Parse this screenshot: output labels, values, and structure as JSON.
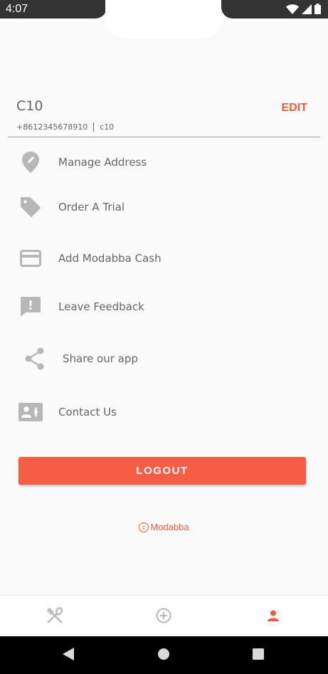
{
  "status_bar": {
    "time": "4:07",
    "icons": [
      "wifi-icon",
      "signal-icon",
      "battery-icon"
    ]
  },
  "profile": {
    "name": "C10",
    "edit_label": "EDIT",
    "phone": "+8612345678910",
    "username": "c10"
  },
  "menu": {
    "items": [
      {
        "label": "Manage Address",
        "icon": "location-pin-icon"
      },
      {
        "label": "Order A Trial",
        "icon": "tag-icon"
      },
      {
        "label": "Add Modabba Cash",
        "icon": "credit-card-icon"
      },
      {
        "label": "Leave Feedback",
        "icon": "feedback-icon"
      },
      {
        "label": "Share our app",
        "icon": "share-icon"
      },
      {
        "label": "Contact Us",
        "icon": "contact-card-icon"
      }
    ]
  },
  "logout_label": "LOGOUT",
  "copyright": {
    "symbol": "c",
    "brand": "Modabba"
  },
  "bottom_nav": {
    "tabs": [
      {
        "icon": "restaurant-icon",
        "active": false
      },
      {
        "icon": "add-circle-icon",
        "active": false
      },
      {
        "icon": "profile-icon",
        "active": true
      }
    ]
  },
  "colors": {
    "accent": "#f05a3c",
    "button": "#f55d45",
    "icon_gray": "#b7b7b7",
    "text_gray": "#666666"
  }
}
